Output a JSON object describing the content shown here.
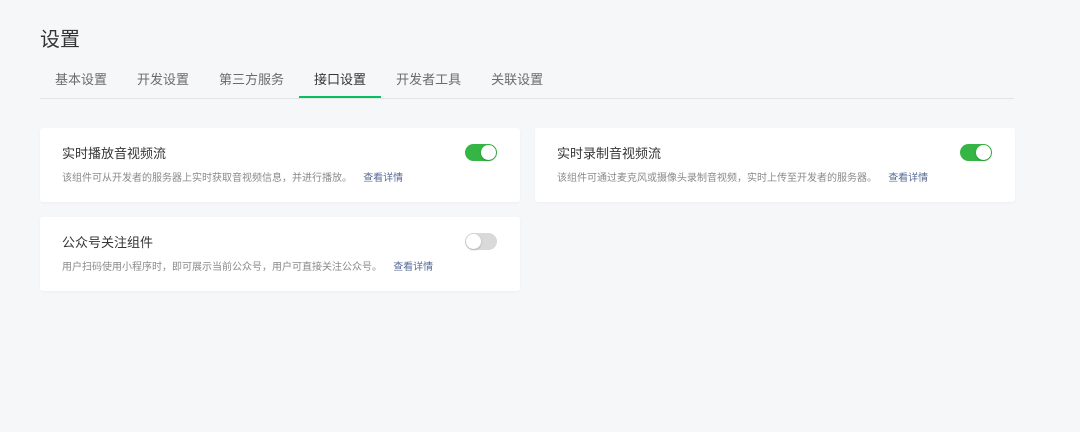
{
  "page": {
    "title": "设置"
  },
  "tabs": [
    {
      "label": "基本设置",
      "active": false
    },
    {
      "label": "开发设置",
      "active": false
    },
    {
      "label": "第三方服务",
      "active": false
    },
    {
      "label": "接口设置",
      "active": true
    },
    {
      "label": "开发者工具",
      "active": false
    },
    {
      "label": "关联设置",
      "active": false
    }
  ],
  "cards": [
    {
      "title": "实时播放音视频流",
      "description": "该组件可从开发者的服务器上实时获取音视频信息，并进行播放。",
      "link": "查看详情",
      "enabled": true
    },
    {
      "title": "实时录制音视频流",
      "description": "该组件可通过麦克风或摄像头录制音视频，实时上传至开发者的服务器。",
      "link": "查看详情",
      "enabled": true
    },
    {
      "title": "公众号关注组件",
      "description": "用户扫码使用小程序时，即可展示当前公众号，用户可直接关注公众号。",
      "link": "查看详情",
      "enabled": false
    }
  ],
  "colors": {
    "toggle_on": "#35b543",
    "toggle_off": "#d9d9d9",
    "active_tab_underline": "#07c160",
    "link": "#576b95"
  }
}
